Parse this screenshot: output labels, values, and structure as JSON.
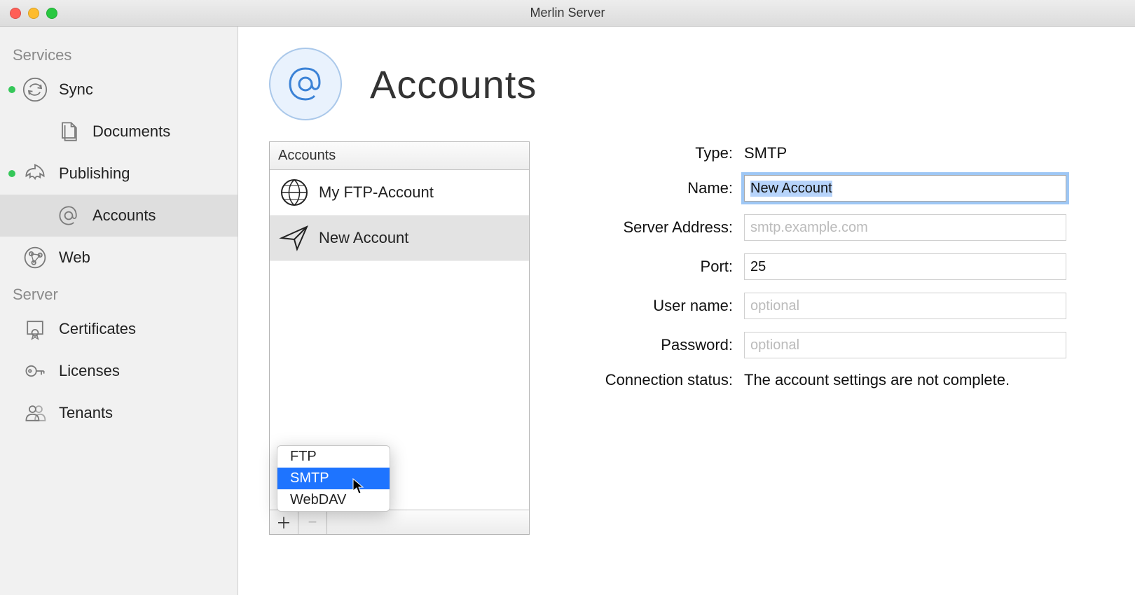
{
  "window": {
    "title": "Merlin Server"
  },
  "sidebar": {
    "groups": [
      {
        "label": "Services",
        "items": [
          {
            "label": "Sync",
            "icon": "sync-icon",
            "status": true
          },
          {
            "label": "Documents",
            "icon": "documents-icon",
            "status": false,
            "indent": 1
          },
          {
            "label": "Publishing",
            "icon": "publishing-icon",
            "status": true
          },
          {
            "label": "Accounts",
            "icon": "at-icon",
            "status": false,
            "indent": 1,
            "selected": true
          },
          {
            "label": "Web",
            "icon": "web-icon",
            "status": false
          }
        ]
      },
      {
        "label": "Server",
        "items": [
          {
            "label": "Certificates",
            "icon": "certificate-icon"
          },
          {
            "label": "Licenses",
            "icon": "key-icon"
          },
          {
            "label": "Tenants",
            "icon": "tenants-icon"
          }
        ]
      }
    ]
  },
  "page": {
    "title": "Accounts",
    "panel_header": "Accounts",
    "accounts": [
      {
        "label": "My FTP-Account",
        "icon": "globe-icon"
      },
      {
        "label": "New Account",
        "icon": "paperplane-icon",
        "selected": true
      }
    ],
    "popup": {
      "items": [
        "FTP",
        "SMTP",
        "WebDAV"
      ],
      "selected_index": 1
    }
  },
  "form": {
    "labels": {
      "type": "Type:",
      "name": "Name:",
      "server": "Server Address:",
      "port": "Port:",
      "user": "User name:",
      "password": "Password:",
      "conn": "Connection status:"
    },
    "type_value": "SMTP",
    "name_value": "New Account",
    "server_placeholder": "smtp.example.com",
    "server_value": "",
    "port_value": "25",
    "user_placeholder": "optional",
    "user_value": "",
    "password_placeholder": "optional",
    "password_value": "",
    "conn_status": "The account settings are not complete."
  }
}
